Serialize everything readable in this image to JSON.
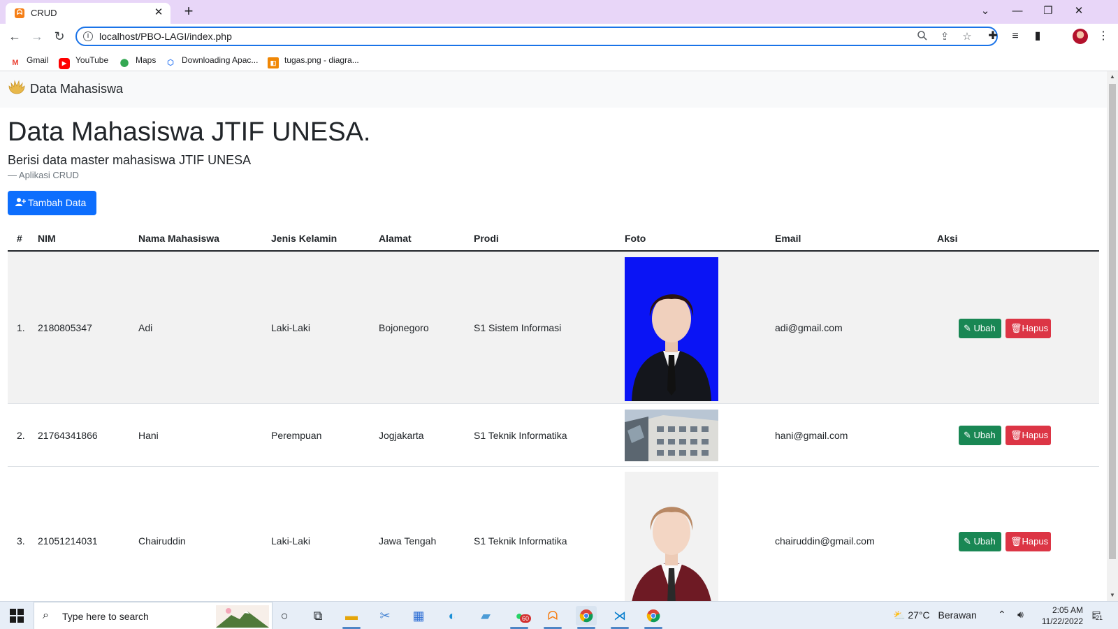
{
  "browser": {
    "tab_title": "CRUD",
    "new_tab": "+",
    "url": "localhost/PBO-LAGI/index.php",
    "bookmarks": [
      {
        "label": "Gmail",
        "icon": "gmail-icon"
      },
      {
        "label": "YouTube",
        "icon": "youtube-icon"
      },
      {
        "label": "Maps",
        "icon": "maps-icon"
      },
      {
        "label": "Downloading Apac...",
        "icon": "hexagon-icon"
      },
      {
        "label": "tugas.png - diagra...",
        "icon": "diagram-icon"
      }
    ]
  },
  "page": {
    "brand": "Data Mahasiswa",
    "title": "Data Mahasiswa JTIF UNESA.",
    "subtitle": "Berisi data master mahasiswa JTIF UNESA",
    "footer_prefix": "—",
    "footer": "Aplikasi CRUD",
    "add_button": "Tambah Data",
    "table": {
      "headers": [
        "#",
        "NIM",
        "Nama Mahasiswa",
        "Jenis Kelamin",
        "Alamat",
        "Prodi",
        "Foto",
        "Email",
        "Aksi"
      ],
      "rows": [
        {
          "no": "1.",
          "nim": "2180805347",
          "nama": "Adi",
          "jk": "Laki-Laki",
          "alamat": "Bojonegoro",
          "prodi": "S1 Sistem Informasi",
          "email": "adi@gmail.com"
        },
        {
          "no": "2.",
          "nim": "21764341866",
          "nama": "Hani",
          "jk": "Perempuan",
          "alamat": "Jogjakarta",
          "prodi": "S1 Teknik Informatika",
          "email": "hani@gmail.com"
        },
        {
          "no": "3.",
          "nim": "21051214031",
          "nama": "Chairuddin",
          "jk": "Laki-Laki",
          "alamat": "Jawa Tengah",
          "prodi": "S1 Teknik Informatika",
          "email": "chairuddin@gmail.com"
        }
      ],
      "edit_label": "Ubah",
      "delete_label": "Hapus"
    }
  },
  "colors": {
    "primary": "#0d6efd",
    "success": "#198754",
    "danger": "#dc3545"
  },
  "taskbar": {
    "search_placeholder": "Type here to search",
    "whatsapp_badge": "60",
    "temperature": "27°C",
    "weather": "Berawan",
    "time": "2:05 AM",
    "date": "11/22/2022",
    "notifications": "21"
  }
}
